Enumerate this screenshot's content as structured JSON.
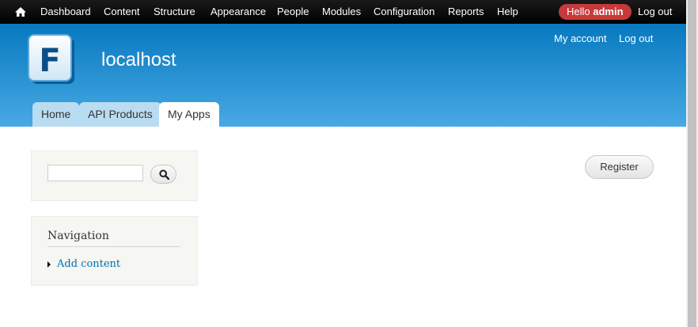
{
  "toolbar": {
    "home_icon": "home-icon",
    "items": [
      "Dashboard",
      "Content",
      "Structure",
      "Appearance",
      "People",
      "Modules",
      "Configuration",
      "Reports",
      "Help"
    ],
    "hello_prefix": "Hello ",
    "hello_user": "admin",
    "logout": "Log out",
    "hello_badge_color": "#c7393b"
  },
  "header": {
    "site_name": "localhost",
    "logo_letter": "F",
    "secondary_menu": [
      "My account",
      "Log out"
    ],
    "tabs": [
      {
        "label": "Home",
        "active": false
      },
      {
        "label": "API Products",
        "active": false
      },
      {
        "label": "My Apps",
        "active": true
      }
    ],
    "gradient_top": "#0779bf",
    "gradient_bottom": "#48a9e4"
  },
  "search": {
    "value": "",
    "placeholder": "",
    "button_icon": "search-icon"
  },
  "navigation": {
    "title": "Navigation",
    "links": [
      "Add content"
    ]
  },
  "main": {
    "register_label": "Register"
  }
}
